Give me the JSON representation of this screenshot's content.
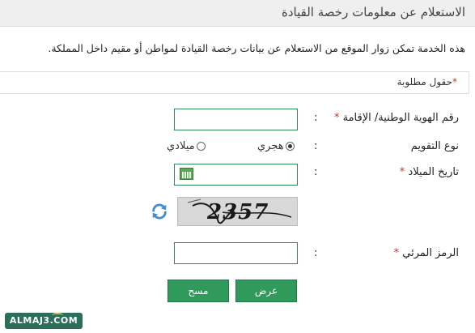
{
  "header": {
    "title": "الاستعلام عن معلومات رخصة القيادة"
  },
  "description": "هذه الخدمة تمكن زوار الموقع من الاستعلام عن بيانات رخصة القيادة لمواطن أو مقيم داخل المملكة.",
  "required_note": {
    "star": "*",
    "text": "حقول مطلوبة"
  },
  "form": {
    "id_label": "رقم الهوية الوطنية/ الإقامة",
    "id_value": "",
    "calendar_label": "نوع التقويم",
    "hijri_label": "هجري",
    "gregorian_label": "ميلادي",
    "calendar_selected": "هجري",
    "dob_label": "تاريخ الميلاد",
    "dob_value": "",
    "captcha_text": "2357",
    "captcha_label": "الرمز المرئي",
    "captcha_value": "",
    "colon": ":",
    "star": "*"
  },
  "buttons": {
    "submit": "عرض",
    "clear": "مسح"
  },
  "watermark": "ALMAJ3.COM",
  "colors": {
    "accent": "#2f9a5b",
    "required": "#c0392b",
    "header_bg": "#efefef"
  }
}
